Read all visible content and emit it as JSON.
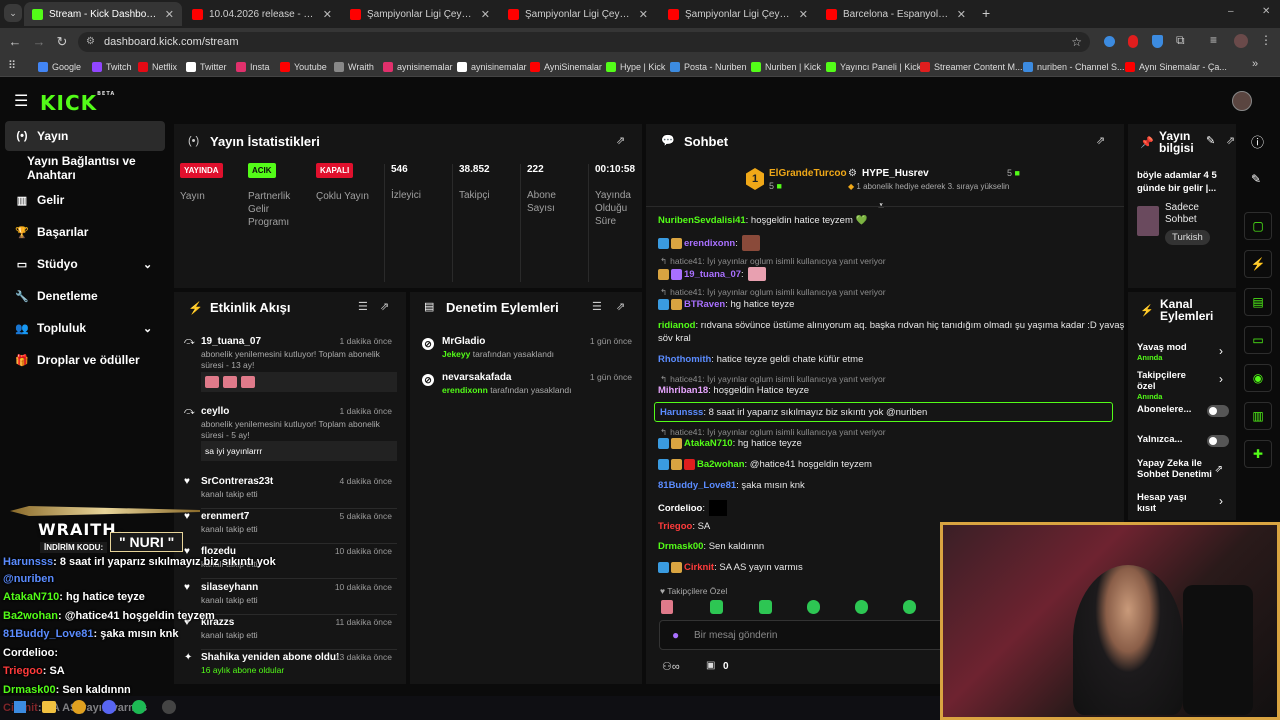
{
  "browser": {
    "tabs": [
      {
        "label": "Stream - Kick Dashboard",
        "color": "#53fc18"
      },
      {
        "label": "10.04.2026 release - YouTube",
        "color": "#ff0000"
      },
      {
        "label": "Şampiyonlar Ligi Çeyrek Final |",
        "color": "#ff0000"
      },
      {
        "label": "Şampiyonlar Ligi Çeyrek Final |",
        "color": "#ff0000"
      },
      {
        "label": "Şampiyonlar Ligi Çeyrek Final |",
        "color": "#ff0000"
      },
      {
        "label": "Barcelona - Espanyol (4-1) - Ma",
        "color": "#ff0000"
      }
    ],
    "url": "dashboard.kick.com/stream",
    "bookmarks": [
      "Google",
      "Twitch",
      "Netflix",
      "Twitter",
      "Insta",
      "Youtube",
      "Wraith",
      "aynisinemalar",
      "aynisinemalar",
      "AyniSinemalar",
      "Hype | Kick",
      "Posta - Nuriben",
      "Nuriben | Kick",
      "Yayıncı Paneli | Kick",
      "Streamer Content M...",
      "nuriben - Channel S...",
      "Aynı Sinemalar - Ça..."
    ]
  },
  "header": {
    "logo": "KICK",
    "beta": "BETA"
  },
  "sidebar": {
    "items": [
      {
        "label": "Yayın",
        "icon": "broadcast-icon"
      },
      {
        "label": "Yayın Bağlantısı ve Anahtarı",
        "icon": ""
      },
      {
        "label": "Gelir",
        "icon": "chart-icon"
      },
      {
        "label": "Başarılar",
        "icon": "trophy-icon"
      },
      {
        "label": "Stüdyo",
        "icon": "studio-icon"
      },
      {
        "label": "Denetleme",
        "icon": "wrench-icon"
      },
      {
        "label": "Topluluk",
        "icon": "people-icon"
      },
      {
        "label": "Droplar ve ödüller",
        "icon": "gift-icon"
      }
    ]
  },
  "stats": {
    "title": "Yayın İstatistikleri",
    "cols": [
      {
        "badge": "YAYINDA",
        "badge_color": "#e0102d",
        "label": "Yayın"
      },
      {
        "badge": "ACIK",
        "badge_color": "#53fc18",
        "label": "Partnerlik Gelir Programı"
      },
      {
        "badge": "KAPALI",
        "badge_color": "#e0102d",
        "label": "Çoklu Yayın"
      },
      {
        "value": "546",
        "label": "İzleyici"
      },
      {
        "value": "38.852",
        "label": "Takipçi"
      },
      {
        "value": "222",
        "label": "Abone Sayısı"
      },
      {
        "value": "00:10:58",
        "label": "Yayında Olduğu Süre"
      }
    ]
  },
  "activity": {
    "title": "Etkinlik Akışı",
    "events": [
      {
        "name": "19_tuana_07",
        "time": "1 dakika önce",
        "desc": "abonelik yenilemesini kutluyor! Toplam abonelik süresi - 13 ay!"
      },
      {
        "name": "ceyllo",
        "time": "1 dakika önce",
        "desc": "abonelik yenilemesini kutluyor! Toplam abonelik süresi - 5 ay!",
        "msg": "sa iyi yayınlarrr"
      },
      {
        "name": "SrContreras23t",
        "time": "4 dakika önce",
        "desc": "kanalı takip etti"
      },
      {
        "name": "erenmert7",
        "time": "5 dakika önce",
        "desc": "kanalı takip etti"
      },
      {
        "name": "flozedu",
        "time": "10 dakika önce",
        "desc": "kanalı takip etti"
      },
      {
        "name": "silaseyhann",
        "time": "10 dakika önce",
        "desc": "kanalı takip etti"
      },
      {
        "name": "kirazzs",
        "time": "11 dakika önce",
        "desc": "kanalı takip etti"
      },
      {
        "name": "Shahika yeniden abone oldu!",
        "time": "13 dakika önce",
        "desc": "16 aylık abone oldular"
      }
    ]
  },
  "moderation": {
    "title": "Denetim Eylemleri",
    "actions": [
      {
        "name": "MrGladio",
        "time": "1 gün önce",
        "by": "Jekeyy",
        "text": "tarafından yasaklandı"
      },
      {
        "name": "nevarsakafada",
        "time": "1 gün önce",
        "by": "erendixonn",
        "text": "tarafından yasaklandı"
      }
    ]
  },
  "chat": {
    "title": "Sohbet",
    "top1": {
      "name": "ElGrandeTurcoo",
      "count": "5"
    },
    "top2": {
      "name": "HYPE_Husrev",
      "count": "5",
      "sub": "1 abonelik hediye ederek 3. sıraya yükselin"
    },
    "lines": [
      {
        "user": "NuribenSevdalisi41",
        "color": "#53fc18",
        "text": ": hoşgeldin hatice teyzem 💚"
      },
      {
        "user": "erendixonn",
        "color": "#a970ff",
        "text": ":"
      },
      {
        "reply": "hatice41: İyi yayınlar oglum isimli kullanıcıya yanıt veriyor"
      },
      {
        "user": "19_tuana_07",
        "color": "#a970ff",
        "text": ":"
      },
      {
        "reply": "hatice41: İyi yayınlar oglum isimli kullanıcıya yanıt veriyor"
      },
      {
        "user": "BTRaven",
        "color": "#a970ff",
        "text": ": hg hatice teyze"
      },
      {
        "user": "ridianod",
        "color": "#53fc18",
        "text": ": rıdvana sövünce üstüme alınıyorum aq. başka rıdvan hiç tanıdığım olmadı şu yaşıma kadar :D yavaş"
      },
      {
        "cont": "söv kral"
      },
      {
        "user": "Rhothomith",
        "color": "#5b8cff",
        "text": ": hatice teyze geldi chate küfür etme"
      },
      {
        "reply": "hatice41: İyi yayınlar oglum isimli kullanıcıya yanıt veriyor"
      },
      {
        "user": "Mihriban18",
        "color": "#e8a6ff",
        "text": ": hoşgeldin Hatice teyze"
      },
      {
        "user": "Harunsss",
        "color": "#5b8cff",
        "text": ": 8 saat irl yaparız sıkılmayız biz sıkıntı yok @nuriben",
        "highlight": true
      },
      {
        "reply": "hatice41: İyi yayınlar oglum isimli kullanıcıya yanıt veriyor"
      },
      {
        "user": "AtakaN710",
        "color": "#53fc18",
        "text": ": hg hatice teyze"
      },
      {
        "user": "Ba2wohan",
        "color": "#53fc18",
        "text": ": @hatice41 hoşgeldin teyzem"
      },
      {
        "user": "81Buddy_Love81",
        "color": "#5b8cff",
        "text": ": şaka mısın knk"
      },
      {
        "user": "Cordelioo",
        "color": "#ffffff",
        "text": ":"
      },
      {
        "user": "Triegoo",
        "color": "#ff3b3b",
        "text": ": SA"
      },
      {
        "user": "Drmask00",
        "color": "#53fc18",
        "text": ": Sen kaldınnn"
      },
      {
        "user": "Cirknit",
        "color": "#ff3b3b",
        "text": ": SA AS yayın varmıs"
      }
    ],
    "followers_only": "Takipçilere Özel",
    "input_placeholder": "Bir mesaj gönderin",
    "counter": "0"
  },
  "stream_info": {
    "title": "Yayın bilgisi",
    "desc": "böyle adamlar 4 5 günde bir gelir |...",
    "category": "Sadece Sohbet",
    "tag": "Turkish"
  },
  "channel_actions": {
    "title": "Kanal Eylemleri",
    "items": [
      {
        "label": "Yavaş mod",
        "sub": "Anında",
        "kind": "arrow"
      },
      {
        "label": "Takipçilere özel",
        "sub": "Anında",
        "kind": "arrow"
      },
      {
        "label": "Abonelere...",
        "sub": "",
        "kind": "toggle"
      },
      {
        "label": "Yalnızca...",
        "sub": "",
        "kind": "toggle"
      },
      {
        "label": "Yapay Zeka ile Sohbet Denetimi",
        "sub": "",
        "kind": "ext"
      },
      {
        "label": "Hesap yaşı kısıt",
        "sub": "",
        "kind": "arrow"
      }
    ]
  },
  "overlay": {
    "brand": "WRAITH.",
    "code_label": "İNDİRİM KODU:",
    "code": "\" NURI \"",
    "lines": [
      {
        "user": "Harunsss",
        "color": "#5b8cff",
        "text": ": 8 saat irl yaparız sıkılmayız biz sıkıntı yok"
      },
      {
        "user": "",
        "color": "#5b8cff",
        "text": "@nuriben"
      },
      {
        "user": "AtakaN710",
        "color": "#53fc18",
        "text": ": hg hatice teyze"
      },
      {
        "user": "Ba2wohan",
        "color": "#53fc18",
        "text": ": @hatice41 hoşgeldin teyzem"
      },
      {
        "user": "81Buddy_Love81",
        "color": "#5b8cff",
        "text": ": şaka mısın knk"
      },
      {
        "user": "Cordelioo",
        "color": "#ffffff",
        "text": ":"
      },
      {
        "user": "Triegoo",
        "color": "#ff3b3b",
        "text": ": SA"
      },
      {
        "user": "Drmask00",
        "color": "#53fc18",
        "text": ": Sen kaldınnn"
      },
      {
        "user": "Cirknit",
        "color": "#ff3b3b",
        "text": ": SA AS yayın varmıs"
      }
    ]
  }
}
